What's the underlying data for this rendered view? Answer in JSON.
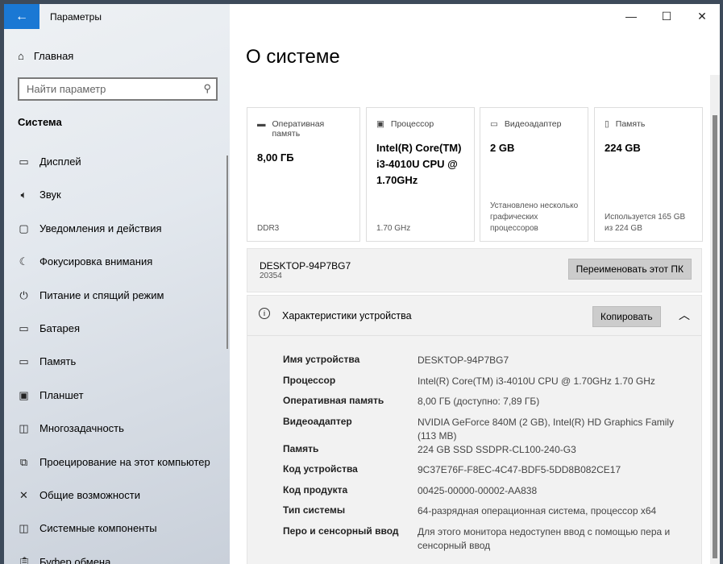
{
  "app_title": "Параметры",
  "home": "Главная",
  "search_placeholder": "Найти параметр",
  "section": "Система",
  "nav": [
    {
      "label": "Дисплей",
      "icon": "display-icon"
    },
    {
      "label": "Звук",
      "icon": "sound-icon"
    },
    {
      "label": "Уведомления и действия",
      "icon": "notifications-icon"
    },
    {
      "label": "Фокусировка внимания",
      "icon": "focus-icon"
    },
    {
      "label": "Питание и спящий режим",
      "icon": "power-icon"
    },
    {
      "label": "Батарея",
      "icon": "battery-icon"
    },
    {
      "label": "Память",
      "icon": "storage-icon"
    },
    {
      "label": "Планшет",
      "icon": "tablet-icon"
    },
    {
      "label": "Многозадачность",
      "icon": "multitasking-icon"
    },
    {
      "label": "Проецирование на этот компьютер",
      "icon": "projecting-icon"
    },
    {
      "label": "Общие возможности",
      "icon": "shared-icon"
    },
    {
      "label": "Системные компоненты",
      "icon": "components-icon"
    },
    {
      "label": "Буфер обмена",
      "icon": "clipboard-icon"
    }
  ],
  "page_title": "О системе",
  "cards": [
    {
      "title": "Оперативная память",
      "value": "8,00 ГБ",
      "sub": "DDR3"
    },
    {
      "title": "Процессор",
      "value": "Intel(R) Core(TM) i3-4010U CPU @ 1.70GHz",
      "sub": "1.70 GHz"
    },
    {
      "title": "Видеоадаптер",
      "value": "2 GB",
      "sub": "Установлено несколько графических процессоров"
    },
    {
      "title": "Память",
      "value": "224 GB",
      "sub": "Используется 165 GB из 224 GB"
    }
  ],
  "pc_name": "DESKTOP-94P7BG7",
  "build": "20354",
  "rename_label": "Переименовать этот ПК",
  "specs_title": "Характеристики устройства",
  "copy_label": "Копировать",
  "specs": [
    {
      "k": "Имя устройства",
      "v": "DESKTOP-94P7BG7"
    },
    {
      "k": "Процессор",
      "v": "Intel(R) Core(TM) i3-4010U CPU @ 1.70GHz   1.70 GHz"
    },
    {
      "k": "Оперативная память",
      "v": "8,00 ГБ (доступно: 7,89 ГБ)"
    },
    {
      "k": "Видеоадаптер",
      "v": "NVIDIA GeForce 840M (2 GB), Intel(R) HD Graphics Family (113 MB)"
    },
    {
      "k": "Память",
      "v": "224 GB SSD SSDPR-CL100-240-G3"
    },
    {
      "k": "Код устройства",
      "v": "9C37E76F-F8EC-4C47-BDF5-5DD8B082CE17"
    },
    {
      "k": "Код продукта",
      "v": "00425-00000-00002-AA838"
    },
    {
      "k": "Тип системы",
      "v": "64-разрядная операционная система, процессор x64"
    },
    {
      "k": "Перо и сенсорный ввод",
      "v": "Для этого монитора недоступен ввод с помощью пера и сенсорный ввод"
    }
  ]
}
